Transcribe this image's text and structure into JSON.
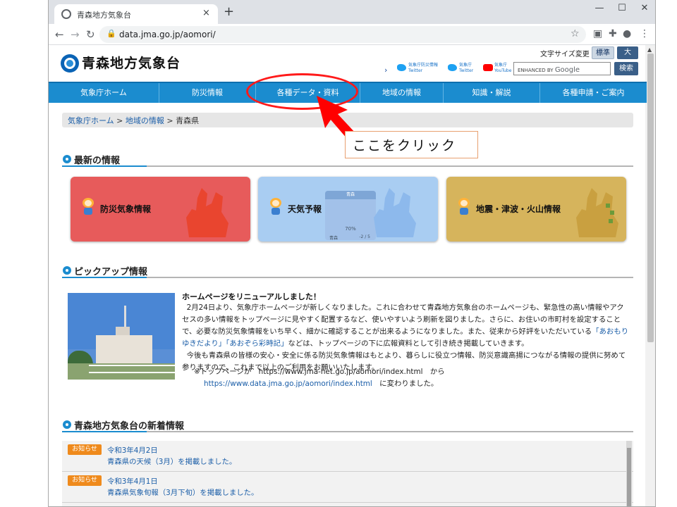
{
  "browser": {
    "tab_title": "青森地方気象台",
    "tab_close": "×",
    "new_tab": "+",
    "url": "data.jma.go.jp/aomori/",
    "min": "—",
    "max": "☐",
    "close": "✕"
  },
  "site": {
    "title": "青森地方気象台",
    "font_size_label": "文字サイズ変更",
    "font_std": "標準",
    "font_big": "大",
    "social": [
      {
        "line1": "気象庁防災情報",
        "line2": "Twitter"
      },
      {
        "line1": "気象庁",
        "line2": "Twitter"
      },
      {
        "line1": "気象庁",
        "line2": "YouTube"
      }
    ],
    "search_placeholder_prefix": "ENHANCED BY",
    "search_placeholder_brand": "Google",
    "search_button": "検索"
  },
  "nav": [
    "気象庁ホーム",
    "防災情報",
    "各種データ・資料",
    "地域の情報",
    "知識・解説",
    "各種申請・ご案内"
  ],
  "breadcrumb": {
    "home": "気象庁ホーム",
    "sep1": " > ",
    "regional": "地域の情報",
    "sep2": " > ",
    "current": "青森県"
  },
  "sections": {
    "latest": "最新の情報",
    "pickup": "ピックアップ情報",
    "news": "青森地方気象台の新着情報"
  },
  "banners": [
    {
      "label": "防災気象情報",
      "color": "#e75b5b"
    },
    {
      "label": "天気予報",
      "color": "#a9cdf2",
      "card_title": "青森",
      "card_pct": "70%",
      "card_city": "青森",
      "card_temp": "-2 / 5"
    },
    {
      "label": "地震・津波・火山情報",
      "color": "#d6b45c"
    }
  ],
  "pickup": {
    "title": "ホームページをリニューアルしました！",
    "p1": "2月24日より、気象庁ホームページが新しくなりました。これに合わせて青森地方気象台のホームページも、緊急性の高い情報やアクセスの多い情報をトップページに見やすく配置するなど、使いやすいよう刷新を図りました。さらに、お住いの市町村を設定することで、必要な防災気象情報をいち早く、細かに確認することが出来るようになりました。また、従来から好評をいただいている",
    "link1": "「あおもりゆきだより」",
    "link2": "「あおぞら彩時記」",
    "p1_end": "などは、トップページの下に広報資料として引き続き掲載していきます。",
    "p2": "今後も青森県の皆様の安心・安全に係る防災気象情報はもとより、暮らしに役立つ情報、防災意識高揚につながる情報の提供に努めて参りますので、これまで以上のご利用をお願いいたします。",
    "url_line1": "※トップページが　https://www.jma-net.go.jp/aomori/index.html　から",
    "url_line2_link": "https://www.data.jma.go.jp/aomori/index.html",
    "url_line2_end": "　に変わりました。"
  },
  "news": [
    {
      "badge": "お知らせ",
      "date": "令和3年4月2日",
      "text": "青森県の天候（3月）を掲載しました。"
    },
    {
      "badge": "お知らせ",
      "date": "令和3年4月1日",
      "text": "青森県気象旬報（3月下旬）を掲載しました。"
    }
  ],
  "annotation": {
    "callout": "ここをクリック",
    "color": "#ff1a1a"
  }
}
